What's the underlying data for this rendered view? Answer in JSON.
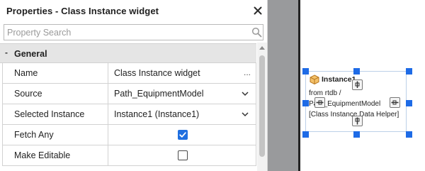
{
  "panel": {
    "title": "Properties - Class Instance widget",
    "search_placeholder": "Property Search",
    "group": {
      "toggle": "-",
      "label": "General"
    },
    "rows": [
      {
        "name": "Name",
        "value": "Class Instance widget",
        "control": "text",
        "action_label": "..."
      },
      {
        "name": "Source",
        "value": "Path_EquipmentModel",
        "control": "dropdown"
      },
      {
        "name": "Selected Instance",
        "value": "Instance1 (Instance1)",
        "control": "dropdown"
      },
      {
        "name": "Fetch Any",
        "control": "checkbox",
        "checked": true
      },
      {
        "name": "Make Editable",
        "control": "checkbox",
        "checked": false
      }
    ]
  },
  "canvas": {
    "widget": {
      "title": "Instance1",
      "line1": "from rtdb /",
      "line2": "Path_EquipmentModel",
      "line3": "[Class Instance Data Helper]"
    }
  },
  "colors": {
    "accent": "#1e6be6",
    "checkbox_checked": "#1f6fe0",
    "group_header_bg": "#e5e5e5",
    "strip": "#999a9c",
    "widget_icon": "#e0a23a"
  },
  "icons": [
    "close-icon",
    "search-icon",
    "chevron-down-icon",
    "checkmark-icon",
    "box-icon",
    "port-icon"
  ]
}
